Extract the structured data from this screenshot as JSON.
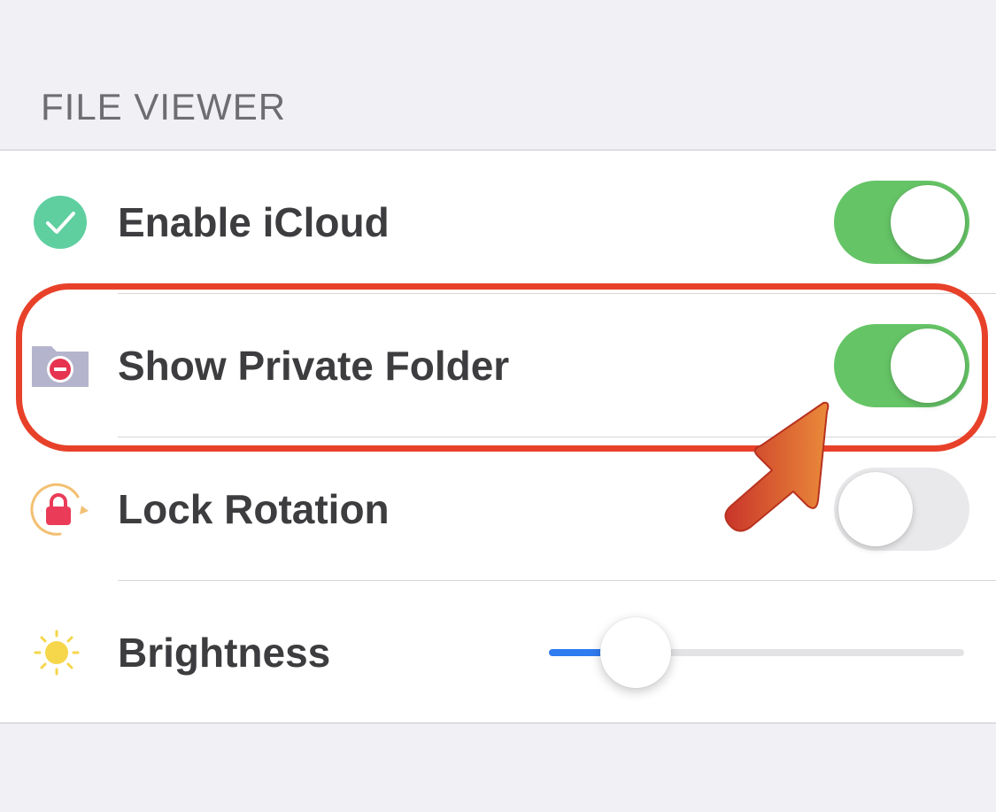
{
  "section": {
    "title": "FILE VIEWER"
  },
  "rows": [
    {
      "label": "Enable iCloud",
      "control": "toggle",
      "on": true,
      "icon": "checkmark-circle-icon"
    },
    {
      "label": "Show Private Folder",
      "control": "toggle",
      "on": true,
      "icon": "private-folder-icon"
    },
    {
      "label": "Lock Rotation",
      "control": "toggle",
      "on": false,
      "icon": "lock-rotation-icon"
    },
    {
      "label": "Brightness",
      "control": "slider",
      "value": 0.15,
      "icon": "sun-icon"
    }
  ],
  "annotations": {
    "highlight_target": "Show Private Folder",
    "highlight_color": "#e8412a",
    "pointer_icon": "arrow-pointer-icon"
  },
  "colors": {
    "toggle_on": "#65c466",
    "toggle_off": "#e9e9eb",
    "slider_fill": "#2f7bf0",
    "icloud_icon": "#5fcfa0",
    "folder_icon": "#b4b5cc",
    "minus_badge": "#e6334f",
    "lock_icon": "#ea3c58",
    "rotation_arrow": "#f3c073",
    "sun_icon": "#f6d64a"
  }
}
